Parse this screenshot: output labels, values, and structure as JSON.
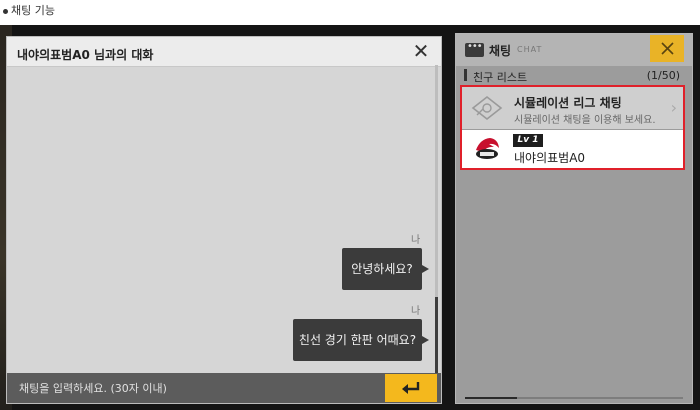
{
  "caption": {
    "text": "채팅 기능"
  },
  "chat": {
    "title": "내야의표범A0 님과의 대화",
    "messages": [
      {
        "sender": "나",
        "text": "안녕하세요?"
      },
      {
        "sender": "나",
        "text": "친선 경기 한판 어때요?"
      }
    ],
    "input_placeholder": "채팅을 입력하세요. (30자 이내)"
  },
  "side": {
    "title": "채팅",
    "subtitle": "CHAT",
    "list_label": "친구 리스트",
    "list_count": "(1/50)",
    "sim": {
      "title": "시뮬레이션 리그 채팅",
      "sub": "시뮬레이션 채팅을 이용해 보세요."
    },
    "user": {
      "level": "Lv 1",
      "name": "내야의표범A0"
    }
  },
  "colors": {
    "accent": "#f4b81d",
    "highlight": "#e0202a",
    "bubble": "#3b3b3b"
  }
}
